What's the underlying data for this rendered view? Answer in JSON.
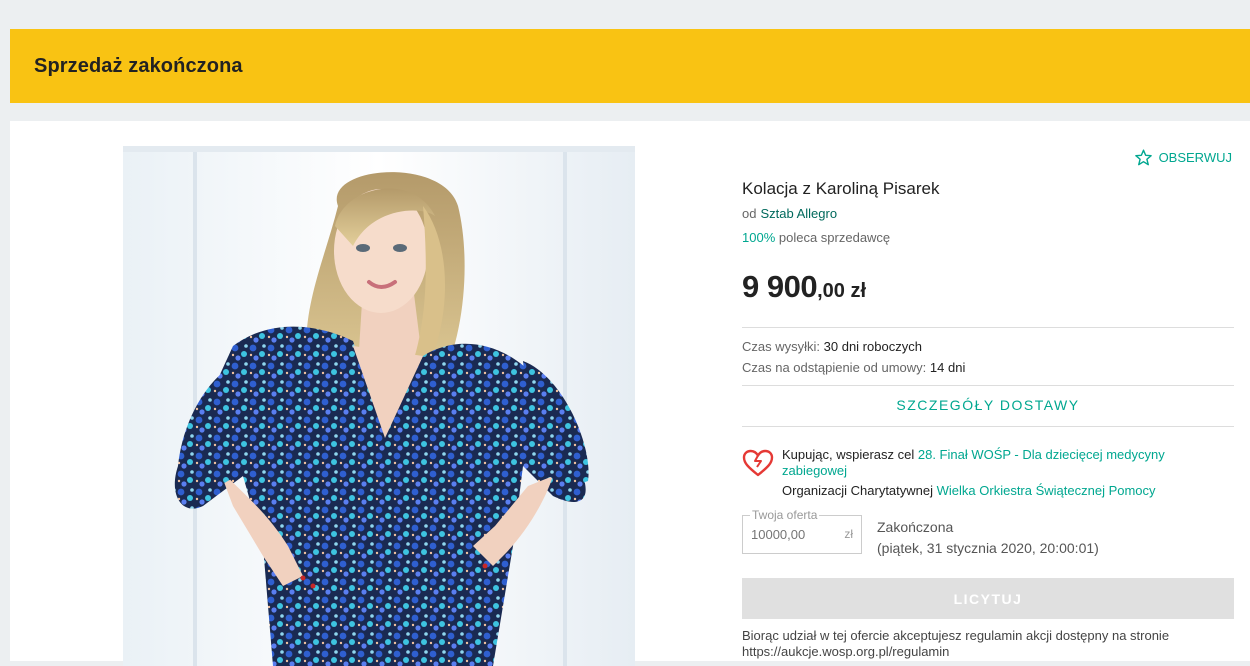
{
  "banner": {
    "text": "Sprzedaż zakończona"
  },
  "watch": {
    "label": "OBSERWUJ"
  },
  "offer": {
    "title": "Kolacja z Karoliną Pisarek",
    "seller_prefix": "od",
    "seller_name": "Sztab Allegro",
    "recommend_pct": "100%",
    "recommend_text": "poleca sprzedawcę",
    "price_main": "9 900",
    "price_cents": ",00 zł"
  },
  "shipping": {
    "time_label": "Czas wysyłki:",
    "time_value": "30 dni roboczych",
    "withdraw_label": "Czas na odstąpienie od umowy:",
    "withdraw_value": "14 dni",
    "details_label": "SZCZEGÓŁY DOSTAWY"
  },
  "charity": {
    "prefix": "Kupując, wspierasz cel",
    "goal": "28. Finał WOŚP - Dla dziecięcej medycyny zabiegowej",
    "org_prefix": "Organizacji Charytatywnej",
    "org_name": "Wielka Orkiestra Świątecznej Pomocy"
  },
  "bid": {
    "field_label": "Twoja oferta",
    "placeholder": "10000,00",
    "currency": "zł",
    "status": "Zakończona",
    "end_date": "(piątek, 31 stycznia 2020, 20:00:01)",
    "button_label": "LICYTUJ"
  },
  "terms": {
    "text": "Biorąc udział w tej ofercie akceptujesz regulamin akcji dostępny na stronie https://aukcje.wosp.org.pl/regulamin"
  },
  "colors": {
    "accent": "#00a790",
    "banner": "#f9c313",
    "heart": "#e53935"
  },
  "icons": {
    "watch": "star-outline-icon",
    "charity": "heart-icon"
  }
}
